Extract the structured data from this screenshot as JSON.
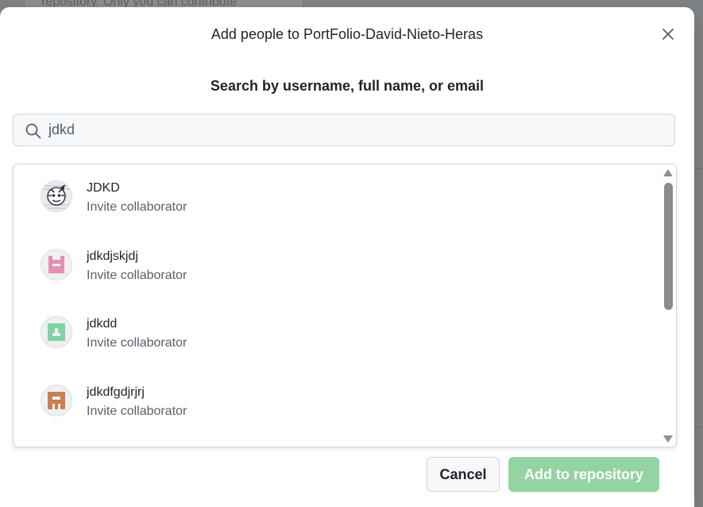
{
  "background": {
    "partial_text": "repository. Only you can contribute"
  },
  "dialog": {
    "title": "Add people to PortFolio-David-Nieto-Heras",
    "close_icon": "close-icon",
    "search_label": "Search by username, full name, or email",
    "search": {
      "value": "jdkd",
      "icon": "search-icon"
    },
    "results": [
      {
        "name": "JDKD",
        "subtitle": "Invite collaborator",
        "avatar": "photo-avatar"
      },
      {
        "name": "jdkdjskjdj",
        "subtitle": "Invite collaborator",
        "avatar": "identicon-pink",
        "color": "#e38fb6"
      },
      {
        "name": "jdkdd",
        "subtitle": "Invite collaborator",
        "avatar": "identicon-green",
        "color": "#7ed4a6"
      },
      {
        "name": "jdkdfgdjrjrj",
        "subtitle": "Invite collaborator",
        "avatar": "identicon-brown",
        "color": "#c97e55"
      }
    ],
    "buttons": {
      "cancel": "Cancel",
      "add": "Add to repository"
    },
    "colors": {
      "add_button_disabled": "#94d3a2",
      "text_primary": "#1f2328",
      "text_muted": "#57606a"
    }
  }
}
